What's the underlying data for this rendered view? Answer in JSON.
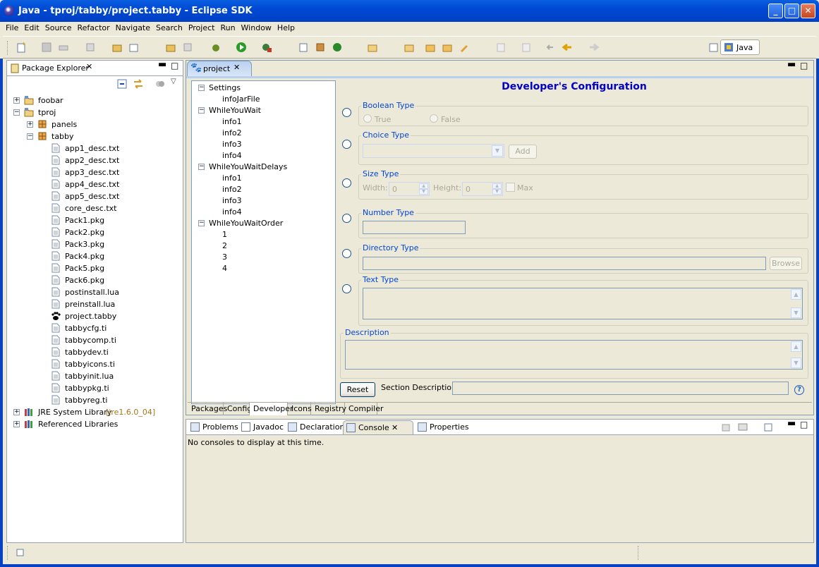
{
  "window": {
    "title": "Java - tproj/tabby/project.tabby - Eclipse SDK"
  },
  "menu": [
    "File",
    "Edit",
    "Source",
    "Refactor",
    "Navigate",
    "Search",
    "Project",
    "Run",
    "Window",
    "Help"
  ],
  "perspective": {
    "label": "Java"
  },
  "package_explorer": {
    "title": "Package Explorer",
    "items": [
      {
        "label": "foobar",
        "level": 0,
        "exp": "+",
        "icon": "project-folder-icon"
      },
      {
        "label": "tproj",
        "level": 0,
        "exp": "-",
        "icon": "project-folder-icon"
      },
      {
        "label": "panels",
        "level": 1,
        "exp": "+",
        "icon": "package-icon"
      },
      {
        "label": "tabby",
        "level": 1,
        "exp": "-",
        "icon": "package-icon"
      },
      {
        "label": "app1_desc.txt",
        "level": 2,
        "icon": "file-icon"
      },
      {
        "label": "app2_desc.txt",
        "level": 2,
        "icon": "file-icon"
      },
      {
        "label": "app3_desc.txt",
        "level": 2,
        "icon": "file-icon"
      },
      {
        "label": "app4_desc.txt",
        "level": 2,
        "icon": "file-icon"
      },
      {
        "label": "app5_desc.txt",
        "level": 2,
        "icon": "file-icon"
      },
      {
        "label": "core_desc.txt",
        "level": 2,
        "icon": "file-icon"
      },
      {
        "label": "Pack1.pkg",
        "level": 2,
        "icon": "file-icon"
      },
      {
        "label": "Pack2.pkg",
        "level": 2,
        "icon": "file-icon"
      },
      {
        "label": "Pack3.pkg",
        "level": 2,
        "icon": "file-icon"
      },
      {
        "label": "Pack4.pkg",
        "level": 2,
        "icon": "file-icon"
      },
      {
        "label": "Pack5.pkg",
        "level": 2,
        "icon": "file-icon"
      },
      {
        "label": "Pack6.pkg",
        "level": 2,
        "icon": "file-icon"
      },
      {
        "label": "postinstall.lua",
        "level": 2,
        "icon": "file-icon"
      },
      {
        "label": "preinstall.lua",
        "level": 2,
        "icon": "file-icon"
      },
      {
        "label": "project.tabby",
        "level": 2,
        "icon": "paw-icon"
      },
      {
        "label": "tabbycfg.ti",
        "level": 2,
        "icon": "file-icon"
      },
      {
        "label": "tabbycomp.ti",
        "level": 2,
        "icon": "file-icon"
      },
      {
        "label": "tabbydev.ti",
        "level": 2,
        "icon": "file-icon"
      },
      {
        "label": "tabbyicons.ti",
        "level": 2,
        "icon": "file-icon"
      },
      {
        "label": "tabbyinit.lua",
        "level": 2,
        "icon": "file-icon"
      },
      {
        "label": "tabbypkg.ti",
        "level": 2,
        "icon": "file-icon"
      },
      {
        "label": "tabbyreg.ti",
        "level": 2,
        "icon": "file-icon"
      },
      {
        "label": "JRE System Library",
        "suffix": "[jre1.6.0_04]",
        "level": 0,
        "exp": "+",
        "icon": "library-icon"
      },
      {
        "label": "Referenced Libraries",
        "level": 0,
        "exp": "+",
        "icon": "library-icon"
      }
    ]
  },
  "editor": {
    "tab": "project",
    "tree": [
      {
        "label": "Settings",
        "level": 0,
        "exp": "-"
      },
      {
        "label": "infoJarFile",
        "level": 1
      },
      {
        "label": "WhileYouWait",
        "level": 0,
        "exp": "-"
      },
      {
        "label": "info1",
        "level": 1
      },
      {
        "label": "info2",
        "level": 1
      },
      {
        "label": "info3",
        "level": 1
      },
      {
        "label": "info4",
        "level": 1
      },
      {
        "label": "WhileYouWaitDelays",
        "level": 0,
        "exp": "-"
      },
      {
        "label": "info1",
        "level": 1
      },
      {
        "label": "info2",
        "level": 1
      },
      {
        "label": "info3",
        "level": 1
      },
      {
        "label": "info4",
        "level": 1
      },
      {
        "label": "WhileYouWaitOrder",
        "level": 0,
        "exp": "-"
      },
      {
        "label": "1",
        "level": 1
      },
      {
        "label": "2",
        "level": 1
      },
      {
        "label": "3",
        "level": 1
      },
      {
        "label": "4",
        "level": 1
      }
    ],
    "heading": "Developer's Configuration",
    "boolean": {
      "label": "Boolean Type",
      "true": "True",
      "false": "False"
    },
    "choice": {
      "label": "Choice Type",
      "add": "Add"
    },
    "size": {
      "label": "Size Type",
      "width_label": "Width:",
      "width": "0",
      "height_label": "Height:",
      "height": "0",
      "max": "Max"
    },
    "number": {
      "label": "Number Type"
    },
    "directory": {
      "label": "Directory Type",
      "browse": "Browse"
    },
    "text": {
      "label": "Text Type"
    },
    "description": {
      "label": "Description"
    },
    "reset": "Reset",
    "section_description": "Section Description:",
    "help": "?",
    "bottom_tabs": [
      "Packages",
      "Config",
      "Developer",
      "Icons",
      "Registry",
      "Compiler"
    ],
    "active_bottom_tab": "Developer"
  },
  "views": {
    "tabs": [
      "Problems",
      "Javadoc",
      "Declaration",
      "Console",
      "Properties"
    ],
    "active": "Console",
    "console_message": "No consoles to display at this time."
  },
  "colors": {
    "titlebar": "#0a5fe0",
    "heading": "#0000c8",
    "group_label": "#0046d5"
  }
}
